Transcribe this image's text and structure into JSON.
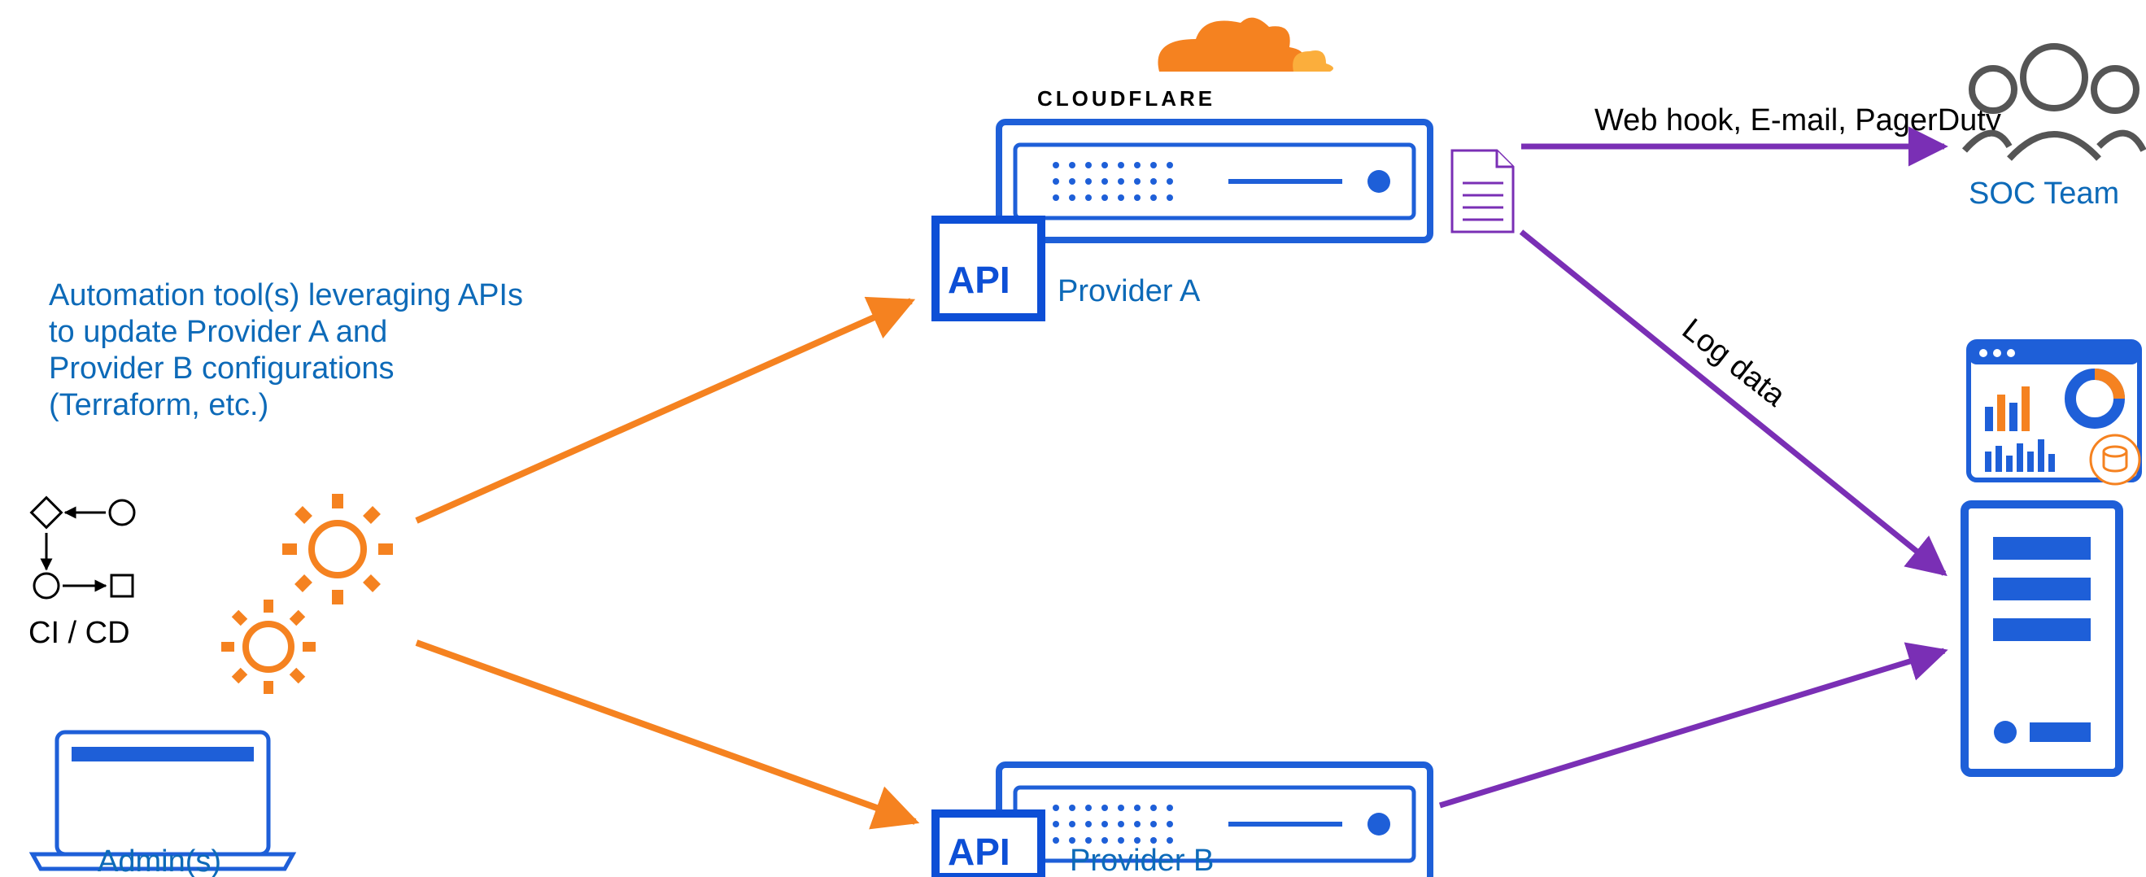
{
  "labels": {
    "automation_l1": "Automation tool(s)  leveraging APIs",
    "automation_l2": "to update Provider A and",
    "automation_l3": "Provider B configurations",
    "automation_l4": "(Terraform, etc.)",
    "cicd": "CI / CD",
    "admins": "Admin(s)",
    "cloudflare": "CLOUDFLARE",
    "provider_a": "Provider A",
    "provider_b": "Provider B",
    "api_a": "API",
    "api_b": "API",
    "webhook": "Web hook, E-mail, PagerDuty",
    "logdata": "Log data",
    "soc": "SOC Team"
  },
  "colors": {
    "blue_text": "#0d6ab8",
    "blue_stroke": "#1e5fd8",
    "orange": "#f58220",
    "purple": "#7a2fb5",
    "grey": "#555555"
  }
}
